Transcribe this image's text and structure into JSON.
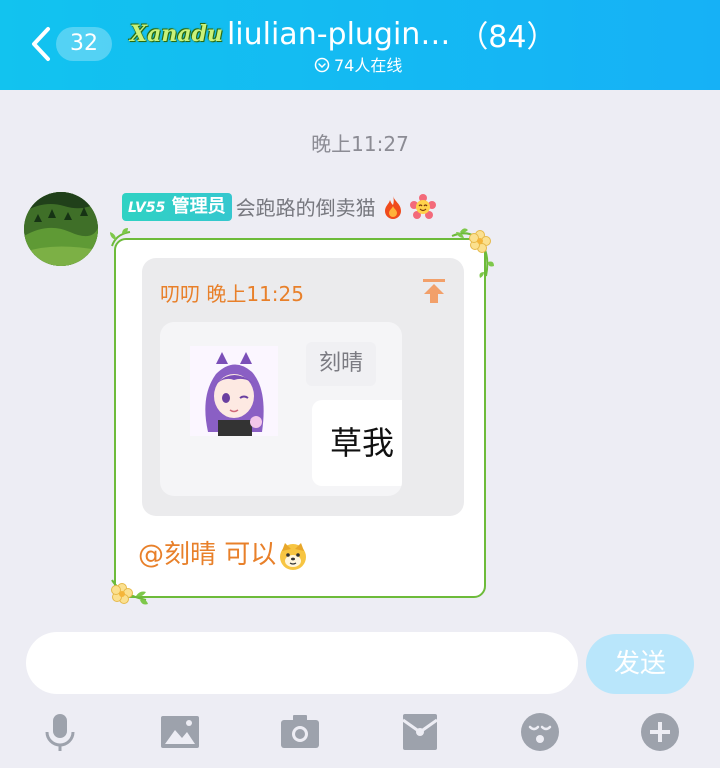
{
  "header": {
    "unread_count": "32",
    "group_logo_text": "Xanadu",
    "group_name": "liulian-plugin…",
    "member_count": "（84）",
    "online_text": "74人在线"
  },
  "chat": {
    "timestamp": "晚上11:27",
    "message": {
      "level_prefix": "LV",
      "level_number": "55",
      "role": "管理员",
      "sender": "会跑路的倒卖猫",
      "quote": {
        "header": "叨叨 晚上11:25",
        "image_name_label": "刻晴",
        "image_bubble_text": "草我"
      },
      "text": "@刻晴 可以"
    }
  },
  "input_bar": {
    "input_value": "",
    "send_label": "发送",
    "icons": [
      "microphone-icon",
      "image-icon",
      "camera-icon",
      "red-packet-icon",
      "emoji-face-icon",
      "plus-circle-icon"
    ]
  },
  "colors": {
    "header_start": "#12c3ef",
    "header_end": "#16b1f6",
    "admin_badge": "#2fd2c3",
    "quote_text": "#e8802a",
    "bubble_border": "#6dbb3a",
    "send_button": "#b9e6fb",
    "toolbar_icon": "#9da2ac"
  }
}
